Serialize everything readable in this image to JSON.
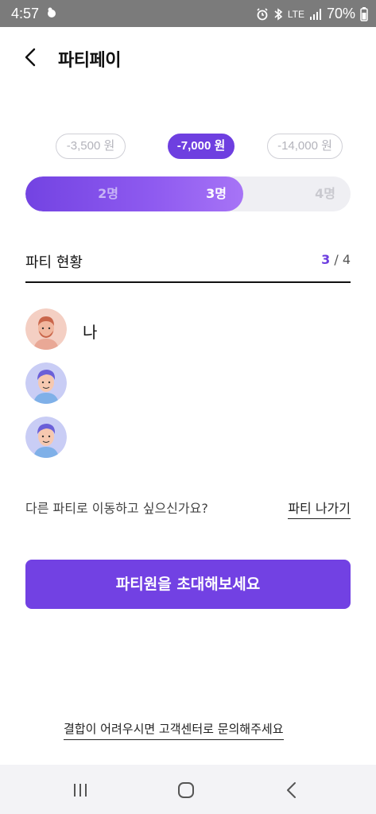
{
  "status_bar": {
    "time": "4:57",
    "network": "LTE",
    "battery": "70%"
  },
  "header": {
    "title": "파티페이"
  },
  "price_options": [
    {
      "label": "-3,500 원",
      "selected": false
    },
    {
      "label": "-7,000 원",
      "selected": true
    },
    {
      "label": "-14,000 원",
      "selected": false
    }
  ],
  "member_options": [
    {
      "label": "2명"
    },
    {
      "label": "3명",
      "selected": true
    },
    {
      "label": "4명"
    }
  ],
  "party_status": {
    "label": "파티 현황",
    "current": "3",
    "separator": "/",
    "max": "4"
  },
  "members": [
    {
      "name": "나",
      "avatar": "person-avatar"
    },
    {
      "name": "",
      "avatar": "person-avatar"
    },
    {
      "name": "",
      "avatar": "person-avatar"
    }
  ],
  "leave": {
    "question": "다른 파티로 이동하고 싶으신가요?",
    "button": "파티 나가기"
  },
  "invite_button": "파티원을 초대해보세요",
  "footer_link": "결합이 어려우시면 고객센터로 문의해주세요",
  "colors": {
    "accent": "#6e3fe0",
    "statusbar": "#7b7b7b"
  }
}
